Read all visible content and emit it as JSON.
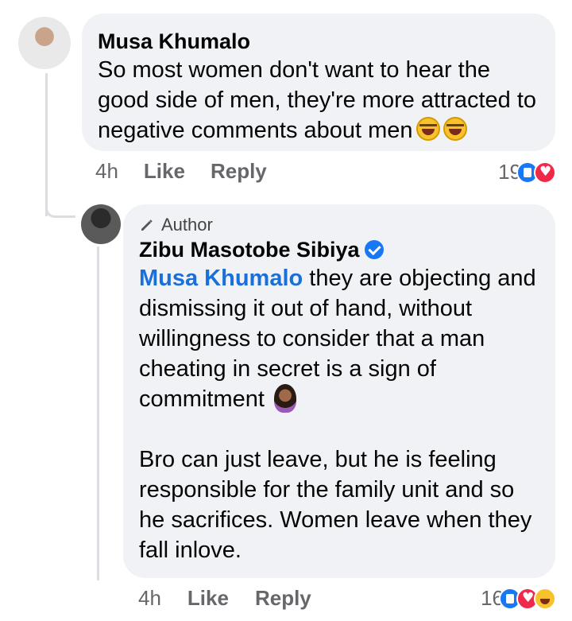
{
  "comments": [
    {
      "author": "Musa Khumalo",
      "text": "So most women don't want to hear the good side of men, they're more attracted to negative comments about men",
      "time": "4h",
      "like_label": "Like",
      "reply_label": "Reply",
      "reaction_count": "19",
      "reactions": [
        "like",
        "love"
      ]
    }
  ],
  "reply": {
    "badge": "Author",
    "author": "Zibu Masotobe Sibiya",
    "mention": "Musa Khumalo",
    "text_part1": " they are objecting and dismissing it out of hand, without willingness to consider that a man cheating in secret is a sign of commitment",
    "text_part2": "Bro can just leave, but he is feeling responsible for the family unit and so he sacrifices. Women leave when they fall inlove.",
    "time": "4h",
    "like_label": "Like",
    "reply_label": "Reply",
    "reaction_count": "16",
    "reactions": [
      "like",
      "love",
      "haha"
    ]
  },
  "colors": {
    "bubble": "#f0f2f5",
    "mention": "#1b6fd9",
    "meta": "#65676b",
    "verified": "#1877f2"
  }
}
